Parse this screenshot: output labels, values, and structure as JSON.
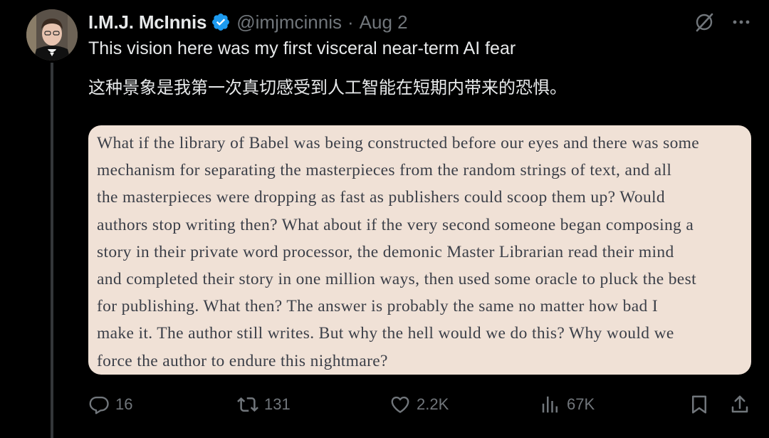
{
  "post": {
    "author_name": "I.M.J. McInnis",
    "handle": "@imjmcinnis",
    "separator": "·",
    "date": "Aug 2",
    "text_en": "This vision here was my first visceral near-term AI fear",
    "text_zh": "这种景象是我第一次真切感受到人工智能在短期内带来的恐惧。"
  },
  "quote_image": {
    "lines": [
      "What if the library of Babel was being constructed before our eyes and there was some",
      "mechanism for separating the masterpieces from the random strings of text, and all",
      "the masterpieces were dropping as fast as publishers could scoop them up? Would",
      "authors stop writing then? What about if the very second someone began composing a",
      "story in their private word processor, the demonic Master Librarian read their mind",
      "and completed their story in one million ways, then used some oracle to pluck the best",
      "for publishing. What then? The answer is probably the same no matter how bad I",
      "make it. The author still writes. But why the hell would we do this? Why would we",
      "force the author to endure this nightmare?"
    ],
    "background": "#f0e1d6",
    "text_color": "#3b3f48"
  },
  "actions": {
    "replies": "16",
    "reposts": "131",
    "likes": "2.2K",
    "views": "67K"
  },
  "icons": {
    "verified": "verified-badge-icon",
    "grok": "grok-icon",
    "more": "more-icon",
    "reply": "reply-icon",
    "repost": "repost-icon",
    "like": "heart-icon",
    "views": "views-icon",
    "bookmark": "bookmark-icon",
    "share": "share-icon"
  },
  "colors": {
    "background": "#000000",
    "text_primary": "#e7e9ea",
    "text_secondary": "#71767b",
    "verified_blue": "#1d9bf0",
    "thread_line": "#333639"
  }
}
